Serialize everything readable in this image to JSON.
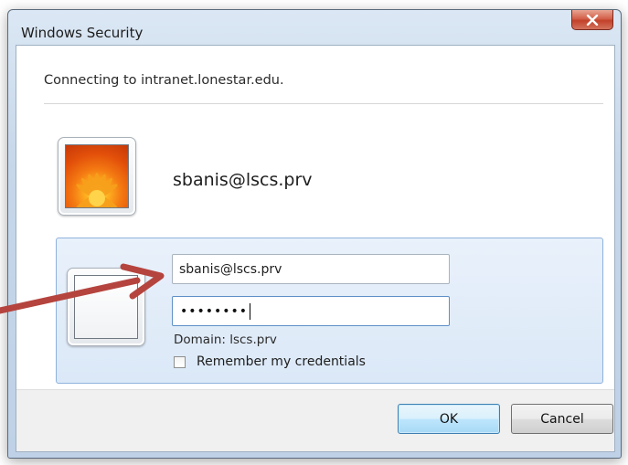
{
  "window": {
    "title": "Windows Security",
    "close_icon": "close-x-icon"
  },
  "message": "Connecting to intranet.lonestar.edu.",
  "account_tile": {
    "username": "sbanis@lscs.prv",
    "picture_icon": "orange-flower-user-picture"
  },
  "credential_form": {
    "tile_icon": "blank-user-tile-icon",
    "username_value": "sbanis@lscs.prv",
    "password_mask": "••••••••",
    "domain_label": "Domain: lscs.prv",
    "remember_label": "Remember my credentials",
    "remember_checked": false
  },
  "buttons": {
    "ok_label": "OK",
    "cancel_label": "Cancel"
  },
  "annotation": {
    "arrow_color": "#b5443e"
  },
  "colors": {
    "panel_border": "#8fb2dc",
    "close_button": "#c2412a",
    "default_button_border": "#3c7fb1"
  }
}
